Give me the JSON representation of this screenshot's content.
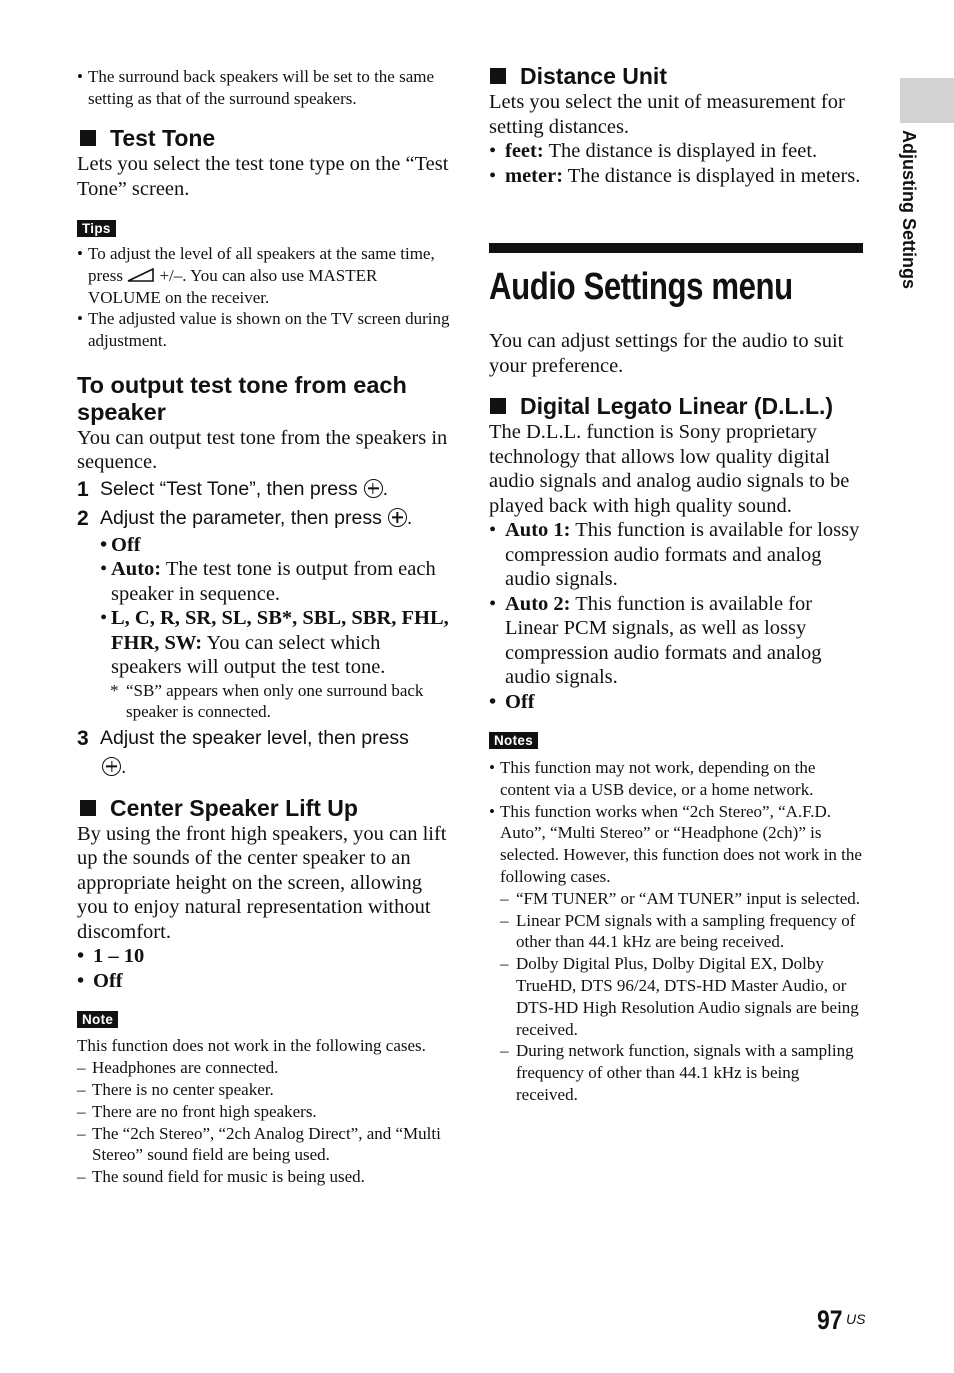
{
  "side_tab": {
    "label": "Adjusting Settings"
  },
  "page": {
    "number": "97",
    "suffix": "US"
  },
  "left": {
    "intro_bullet": "The surround back speakers will be set to the same setting as that of the surround speakers.",
    "test_tone": {
      "heading": "Test Tone",
      "description": "Lets you select the test tone type on the “Test Tone” screen.",
      "tips_badge": "Tips",
      "tips": [
        {
          "before": "To adjust the level of all speakers at the same time, press",
          "icon": "volume-icon",
          "after": "+/–. You can also use MASTER VOLUME on the receiver."
        },
        {
          "text": "The adjusted value is shown on the TV screen during adjustment."
        }
      ]
    },
    "output_each": {
      "heading": "To output test tone from each speaker",
      "description": "You can output test tone from the speakers in sequence.",
      "steps": [
        {
          "num": "1",
          "text": "Select “Test Tone”, then press",
          "icon": "enter-button-icon"
        },
        {
          "num": "2",
          "text": "Adjust the parameter, then press",
          "icon": "enter-button-icon"
        },
        {
          "num": "3",
          "text": "Adjust the speaker level, then press",
          "icon": "enter-button-icon"
        }
      ],
      "options": [
        {
          "label": "Off",
          "text": ""
        },
        {
          "label": "Auto:",
          "text": "The test tone is output from each speaker in sequence."
        },
        {
          "label": "L, C, R, SR, SL, SB*, SBL, SBR, FHL, FHR, SW:",
          "text": "You can select which speakers will output the test tone."
        }
      ],
      "footnote": "“SB” appears when only one surround back speaker is connected."
    },
    "center_lift": {
      "heading": "Center Speaker Lift Up",
      "description": "By using the front high speakers, you can lift up the sounds of the center speaker to an appropriate height on the screen, allowing you to enjoy natural representation without discomfort.",
      "options": [
        "1 – 10",
        "Off"
      ],
      "note_badge": "Note",
      "note_intro": "This function does not work in the following cases.",
      "note_cases": [
        "Headphones are connected.",
        "There is no center speaker.",
        "There are no front high speakers.",
        "The “2ch Stereo”, “2ch Analog Direct”, and “Multi Stereo” sound field are being used.",
        "The sound field for music is being used."
      ]
    }
  },
  "right": {
    "distance_unit": {
      "heading": "Distance Unit",
      "description": "Lets you select the unit of measurement for setting distances.",
      "options": [
        {
          "label": "feet:",
          "text": "The distance is displayed in feet."
        },
        {
          "label": "meter:",
          "text": "The distance is displayed in meters."
        }
      ]
    },
    "audio_menu": {
      "title": "Audio Settings menu",
      "description": "You can adjust settings for the audio to suit your preference."
    },
    "dll": {
      "heading": "Digital Legato Linear (D.L.L.)",
      "description": "The D.L.L. function is Sony proprietary technology that allows low quality digital audio signals and analog audio signals to be played back with high quality sound.",
      "options": [
        {
          "label": "Auto 1:",
          "text": "This function is available for lossy compression audio formats and analog audio signals."
        },
        {
          "label": "Auto 2:",
          "text": "This function is available for Linear PCM signals, as well as lossy compression audio formats and analog audio signals."
        },
        {
          "label": "Off",
          "text": ""
        }
      ],
      "notes_badge": "Notes",
      "notes": [
        "This function may not work, depending on the content via a USB device, or a home network.",
        "This function works when “2ch Stereo”, “A.F.D. Auto”, “Multi Stereo” or “Headphone (2ch)” is selected. However, this function does not work in the following cases."
      ],
      "note_cases": [
        "“FM TUNER” or “AM TUNER” input is selected.",
        "Linear PCM signals with a sampling frequency of other than 44.1 kHz are being received.",
        "Dolby Digital Plus, Dolby Digital EX, Dolby TrueHD, DTS 96/24, DTS-HD Master Audio, or DTS-HD High Resolution Audio signals are being received.",
        "During network function, signals with a sampling frequency of other than 44.1 kHz is being received."
      ]
    }
  }
}
